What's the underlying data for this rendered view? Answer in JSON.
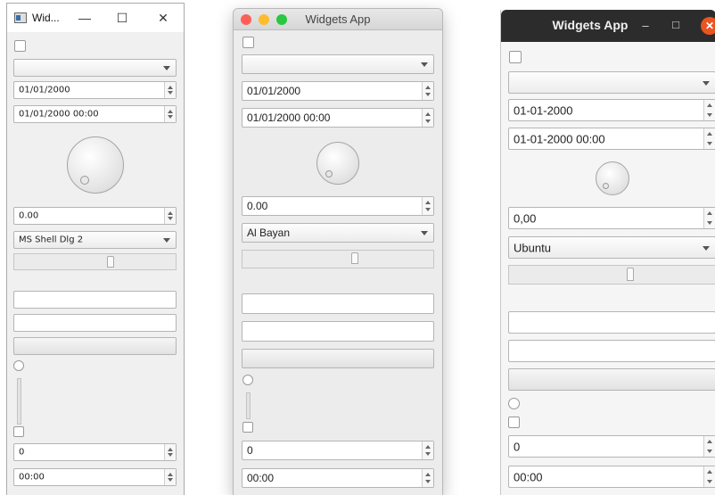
{
  "windows": {
    "title": "Wid...",
    "controls": {
      "minimize": "—",
      "maximize": "☐",
      "close": "✕"
    },
    "date": "01/01/2000",
    "datetime": "01/01/2000 00:00",
    "double_value": "0.00",
    "font": "MS Shell Dlg 2",
    "spin_value": "0",
    "time": "00:00"
  },
  "mac": {
    "title": "Widgets App",
    "traffic_colors": {
      "close": "#fc5f57",
      "minimize": "#fdbc2e",
      "zoom": "#28c840"
    },
    "date": "01/01/2000",
    "datetime": "01/01/2000 00:00",
    "double_value": "0.00",
    "font": "Al Bayan",
    "spin_value": "0",
    "time": "00:00"
  },
  "ubuntu": {
    "title": "Widgets App",
    "controls": {
      "minimize": "–",
      "maximize": "□",
      "close": "✕"
    },
    "close_color": "#e95420",
    "date": "01-01-2000",
    "datetime": "01-01-2000 00:00",
    "double_value": "0,00",
    "font": "Ubuntu",
    "spin_value": "0",
    "time": "00:00"
  }
}
